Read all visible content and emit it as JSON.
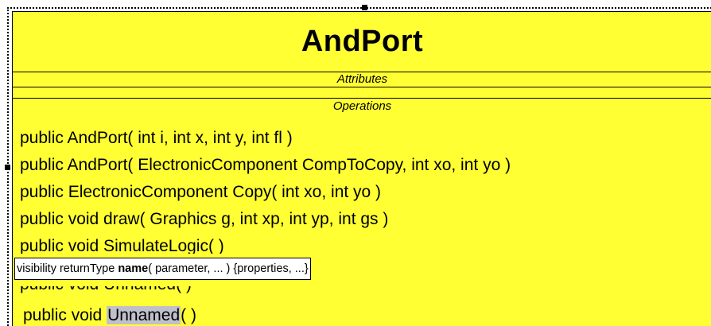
{
  "class": {
    "name": "AndPort",
    "attributes_label": "Attributes",
    "operations_label": "Operations",
    "operations": [
      "public  AndPort( int i, int x, int y, int fl )",
      "public  AndPort( ElectronicComponent CompToCopy, int xo, int yo )",
      "public ElectronicComponent Copy( int xo, int yo )",
      "public void draw( Graphics g, int xp, int yp, int gs )",
      "public void SimulateLogic(  )",
      "public void Unnamed(  )"
    ],
    "editing": {
      "prefix": "public void ",
      "name": "Unnamed",
      "suffix": "(  )"
    }
  },
  "tooltip": {
    "before": "visibility returnType ",
    "bold": "name",
    "after": "( parameter, ... ) {properties, ...}"
  },
  "colors": {
    "class_fill": "#ffff33",
    "selection_highlight": "#c0c0cc"
  }
}
